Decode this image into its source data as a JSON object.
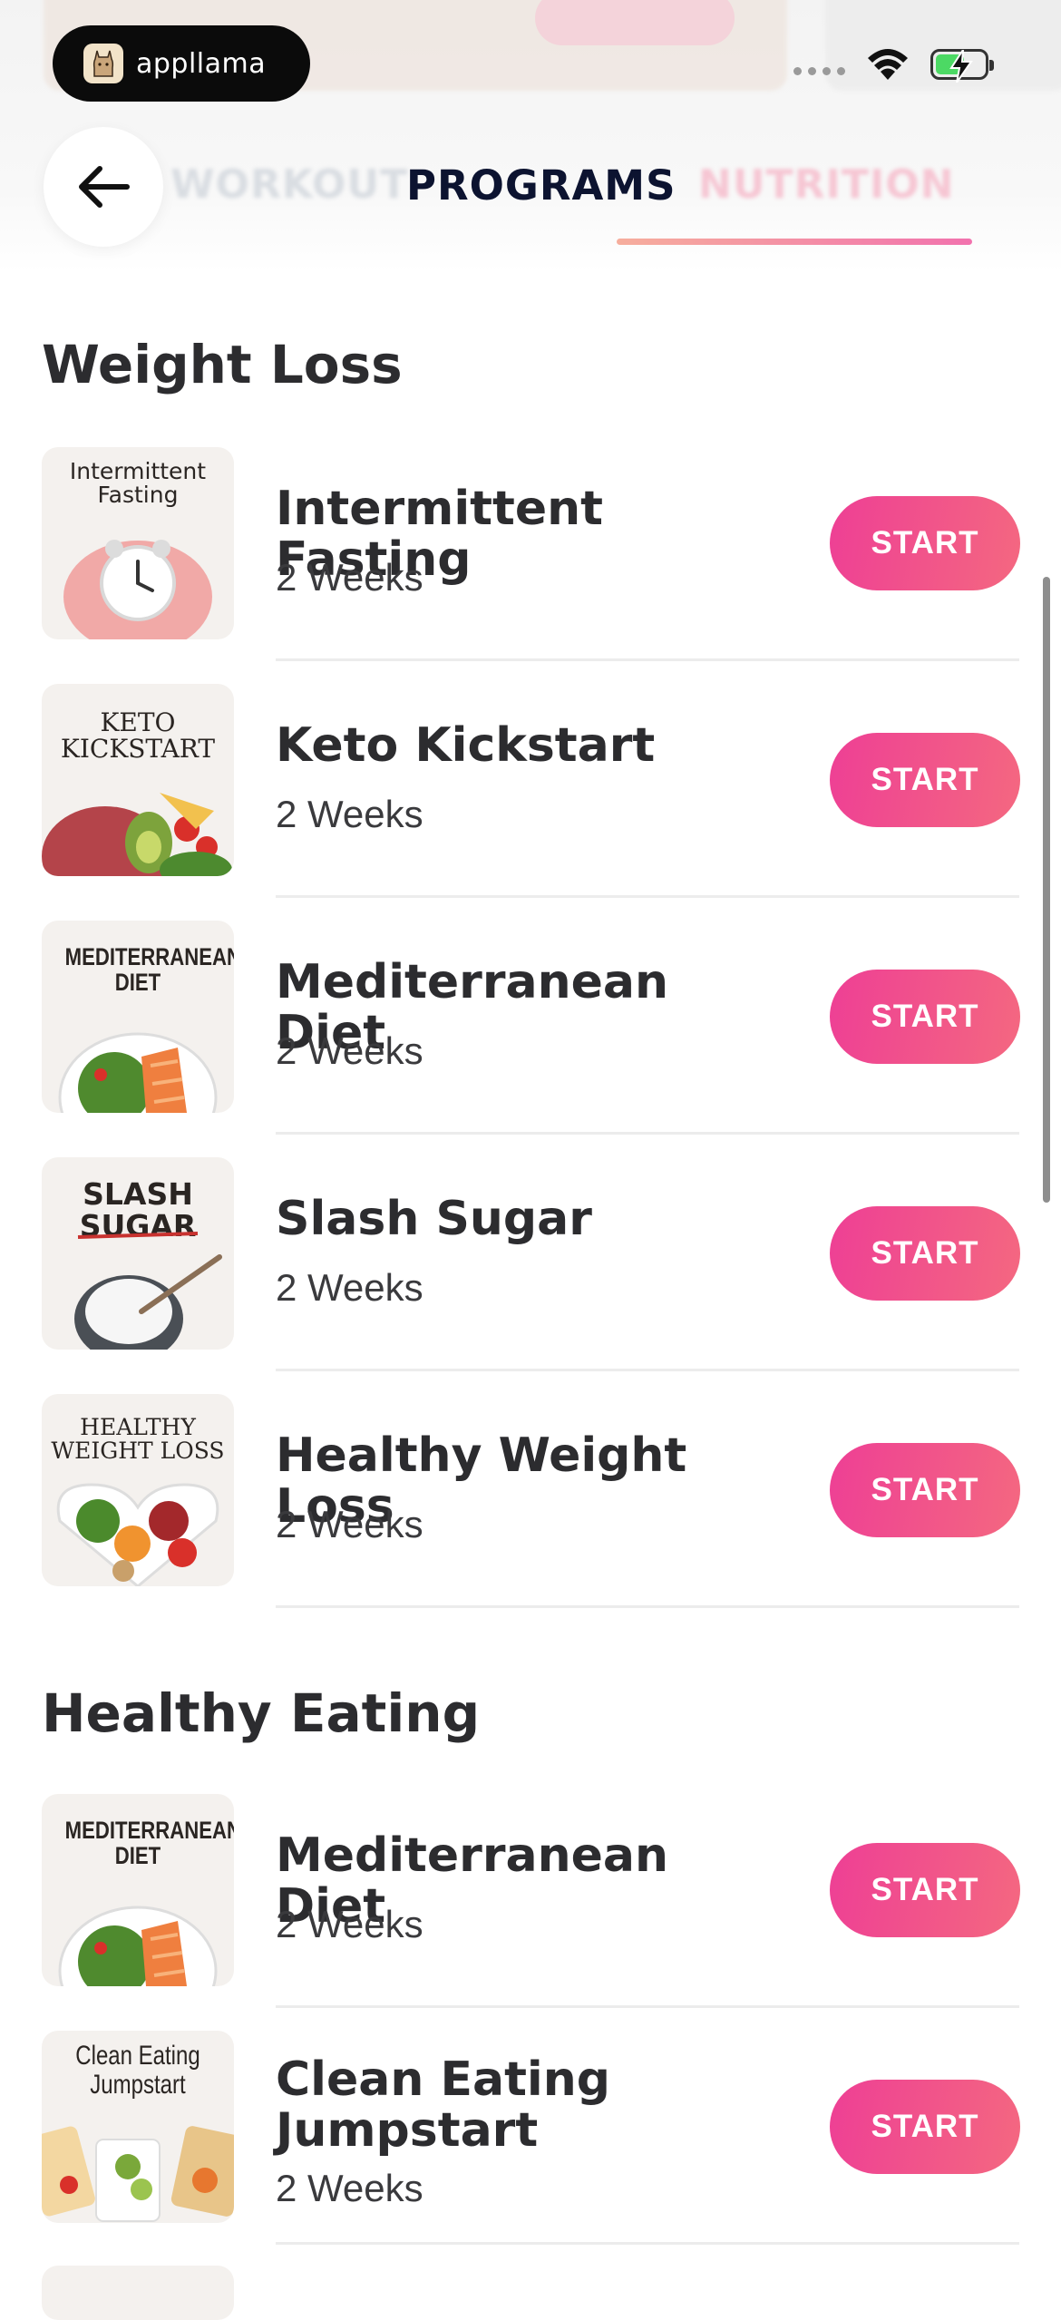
{
  "status": {
    "brand": "appllama"
  },
  "tabs": [
    {
      "label": "WORKOUT",
      "active": false
    },
    {
      "label": "PROGRAMS",
      "active": true
    },
    {
      "label": "NUTRITION",
      "active": false
    }
  ],
  "sections": [
    {
      "title": "Weight Loss",
      "items": [
        {
          "title": "Intermittent Fasting",
          "duration": "2 Weeks",
          "thumb_label": "Intermittent Fasting",
          "button": "START"
        },
        {
          "title": "Keto Kickstart",
          "duration": "2 Weeks",
          "thumb_label": "KETO KICKSTART",
          "button": "START"
        },
        {
          "title": "Mediterranean Diet",
          "duration": "2 Weeks",
          "thumb_label": "MEDITERRANEAN DIET",
          "button": "START"
        },
        {
          "title": "Slash Sugar",
          "duration": "2 Weeks",
          "thumb_label": "SLASH SUGAR",
          "button": "START"
        },
        {
          "title": "Healthy Weight Loss",
          "duration": "2 Weeks",
          "thumb_label": "HEALTHY WEIGHT LOSS",
          "button": "START"
        }
      ]
    },
    {
      "title": "Healthy Eating",
      "items": [
        {
          "title": "Mediterranean Diet",
          "duration": "2 Weeks",
          "thumb_label": "MEDITERRANEAN DIET",
          "button": "START"
        },
        {
          "title": "Clean Eating Jumpstart",
          "duration": "2 Weeks",
          "thumb_label": "Clean Eating Jumpstart",
          "button": "START"
        }
      ]
    }
  ],
  "colors": {
    "accent_start": "#ee3f95",
    "accent_end": "#f46880",
    "active_tab": "#0c1330"
  }
}
